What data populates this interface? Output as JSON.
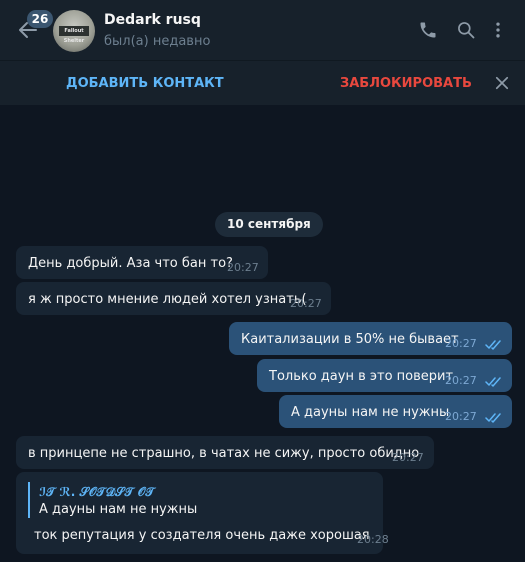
{
  "header": {
    "unread_count": "26",
    "contact_name": "Dedark rusq",
    "contact_status": "был(а) недавно",
    "avatar_label": "Fallout Shelter"
  },
  "action_bar": {
    "add_contact_label": "ДОБАВИТЬ КОНТАКТ",
    "block_label": "ЗАБЛОКИРОВАТЬ"
  },
  "chat": {
    "date_separator": "10 сентября",
    "messages": [
      {
        "direction": "in",
        "text": "День добрый. Аза что бан то?",
        "time": "20:27"
      },
      {
        "direction": "in",
        "text": "я ж просто мнение людей хотел узнать(",
        "time": "20:27"
      },
      {
        "direction": "out",
        "text": "Каитализации в 50% не бывает",
        "time": "20:27",
        "read": true
      },
      {
        "direction": "out",
        "text": "Только даун в это поверит",
        "time": "20:27",
        "read": true
      },
      {
        "direction": "out",
        "text": "А дауны нам не нужны",
        "time": "20:27",
        "read": true
      },
      {
        "direction": "in",
        "text": "в принцепе не страшно, в чатах не сижу, просто обидно",
        "time": "20:27"
      }
    ],
    "reply_message": {
      "quote_author": "ℐ𝒯 ℛ. 𝒮𝒪𝒯𝒟𝒮𝒯 𝒪𝒯",
      "quote_text": "А дауны нам не нужны",
      "text": "ток репутация у создателя очень даже хорошая",
      "time": "20:28"
    }
  },
  "icons": {
    "back": "arrow-left-icon",
    "call": "phone-icon",
    "search": "search-icon",
    "menu": "more-vertical-icon",
    "close": "close-icon",
    "read_receipt": "double-check-icon"
  },
  "colors": {
    "background": "#0e1621",
    "header": "#17212b",
    "incoming_bubble": "#182533",
    "outgoing_bubble": "#2b5278",
    "accent": "#5eb5f7",
    "danger": "#e8483e"
  }
}
